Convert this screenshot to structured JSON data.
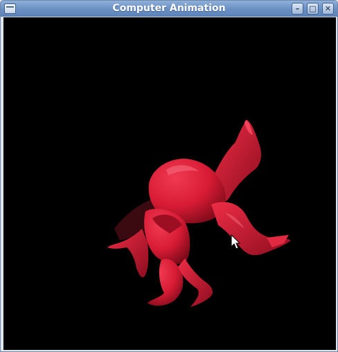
{
  "window": {
    "title": "Computer Animation",
    "controls": {
      "minimize": "–",
      "maximize": "□",
      "close": "✕"
    }
  },
  "viewport": {
    "background_color": "#000000",
    "model_color": "#d81b35"
  },
  "icons": [
    "window-menu-icon",
    "minimize-icon",
    "maximize-icon",
    "close-icon",
    "mouse-cursor-icon"
  ]
}
